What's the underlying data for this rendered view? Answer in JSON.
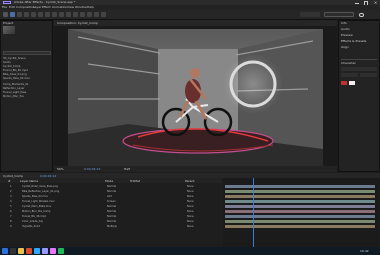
{
  "window": {
    "title": "Adobe After Effects - Cyclist_Scene.aep *"
  },
  "menu": [
    "File",
    "Edit",
    "Composition",
    "Layer",
    "Effect",
    "Animation",
    "View",
    "Window",
    "Help"
  ],
  "project_panel": {
    "tab": "Project",
    "items": [
      "3D_Cyclist_Scene",
      "Solids",
      "Cyclist_Comp",
      "Tunnel_BG_4K.mp4",
      "Bike_Glow_01.png",
      "Sparks_Pass_02.mov",
      "Comp_Elements_01",
      "Reflection_Layer",
      "Tunnel_Light_Pass",
      "Motion_Blur_Pre"
    ]
  },
  "viewer": {
    "tab": "Composition: Cyclist_Comp",
    "zoom": "50%",
    "resolution": "Half",
    "time": "0:00:04:12"
  },
  "right_panel": {
    "tabs": [
      "Info",
      "Audio",
      "Preview",
      "Effects & Presets",
      "Align"
    ],
    "header": "Character"
  },
  "timeline": {
    "tab": "Cyclist_Comp",
    "time": "0:00:04:12",
    "columns": [
      "#",
      "Layer Name",
      "Mode",
      "TrkMat",
      "Parent"
    ],
    "layers": [
      {
        "num": "1",
        "name": "Cyclist_Rider_Glow_Pass.png",
        "mode": "Normal",
        "parent": "None"
      },
      {
        "num": "2",
        "name": "Bike_Reflection_Layer_01.png",
        "mode": "Normal",
        "parent": "None"
      },
      {
        "num": "3",
        "name": "Sparks_Pass_02.mov",
        "mode": "Add",
        "parent": "None"
      },
      {
        "num": "4",
        "name": "Tunnel_Light_Streaks.mov",
        "mode": "Screen",
        "parent": "None"
      },
      {
        "num": "5",
        "name": "Cyclist_Main_Plate.mov",
        "mode": "Normal",
        "parent": "None"
      },
      {
        "num": "6",
        "name": "Motion_Blur_Pre_Comp",
        "mode": "Normal",
        "parent": "None"
      },
      {
        "num": "7",
        "name": "Tunnel_BG_4K.mp4",
        "mode": "Normal",
        "parent": "None"
      },
      {
        "num": "8",
        "name": "Color_Grade_Adj",
        "mode": "Normal",
        "parent": "None"
      },
      {
        "num": "9",
        "name": "Vignette_Solid",
        "mode": "Multiply",
        "parent": "None"
      }
    ]
  },
  "taskbar": {
    "clock": "10:42"
  }
}
